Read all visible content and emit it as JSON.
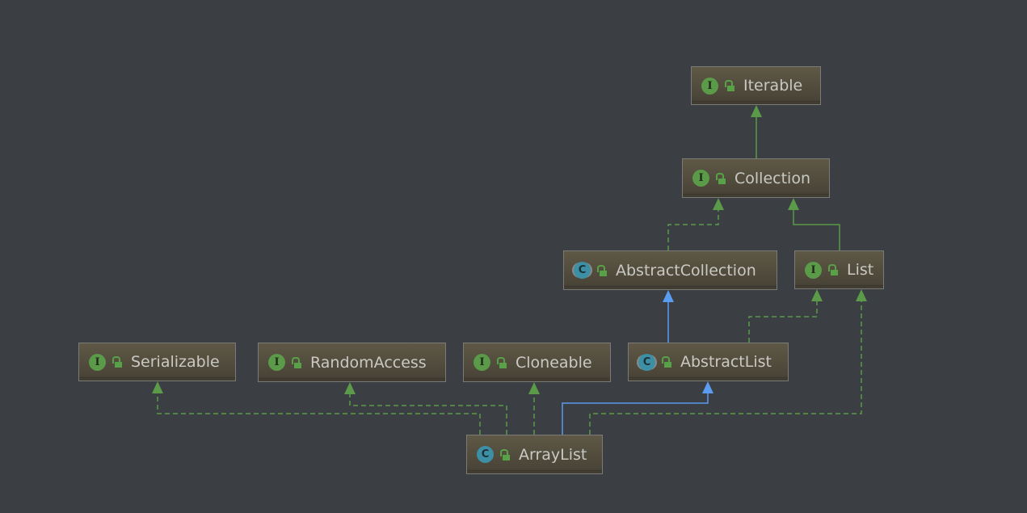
{
  "colors": {
    "background": "#3b3e43",
    "implements": "#5a9a48",
    "extends_interface": "#5a9a48",
    "extends_class": "#5a9cf0"
  },
  "nodes": {
    "iterable": {
      "label": "Iterable",
      "kind": "interface",
      "kind_letter": "I",
      "icon": "interface-icon"
    },
    "collection": {
      "label": "Collection",
      "kind": "interface",
      "kind_letter": "I",
      "icon": "interface-icon"
    },
    "abstract_collection": {
      "label": "AbstractCollection",
      "kind": "abstract-class",
      "kind_letter": "C",
      "icon": "abstract-class-icon"
    },
    "list": {
      "label": "List",
      "kind": "interface",
      "kind_letter": "I",
      "icon": "interface-icon"
    },
    "serializable": {
      "label": "Serializable",
      "kind": "interface",
      "kind_letter": "I",
      "icon": "interface-icon"
    },
    "random_access": {
      "label": "RandomAccess",
      "kind": "interface",
      "kind_letter": "I",
      "icon": "interface-icon"
    },
    "cloneable": {
      "label": "Cloneable",
      "kind": "interface",
      "kind_letter": "I",
      "icon": "interface-icon"
    },
    "abstract_list": {
      "label": "AbstractList",
      "kind": "abstract-class",
      "kind_letter": "C",
      "icon": "abstract-class-icon"
    },
    "array_list": {
      "label": "ArrayList",
      "kind": "class",
      "kind_letter": "C",
      "icon": "class-icon"
    }
  },
  "edges": [
    {
      "from": "Collection",
      "to": "Iterable",
      "type": "extends"
    },
    {
      "from": "AbstractCollection",
      "to": "Collection",
      "type": "implements"
    },
    {
      "from": "List",
      "to": "Collection",
      "type": "extends"
    },
    {
      "from": "AbstractList",
      "to": "AbstractCollection",
      "type": "extends-class"
    },
    {
      "from": "AbstractList",
      "to": "List",
      "type": "implements"
    },
    {
      "from": "ArrayList",
      "to": "List",
      "type": "implements"
    },
    {
      "from": "ArrayList",
      "to": "AbstractList",
      "type": "extends-class"
    },
    {
      "from": "ArrayList",
      "to": "Cloneable",
      "type": "implements"
    },
    {
      "from": "ArrayList",
      "to": "RandomAccess",
      "type": "implements"
    },
    {
      "from": "ArrayList",
      "to": "Serializable",
      "type": "implements"
    }
  ]
}
